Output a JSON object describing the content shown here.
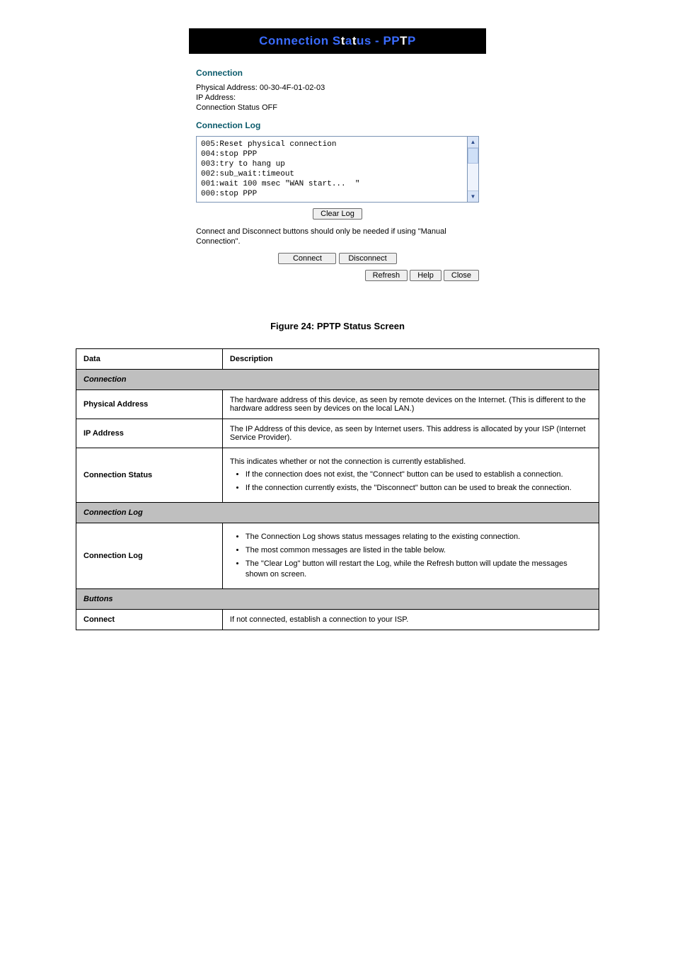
{
  "screenshot": {
    "banner_prefix": "Connection S",
    "banner_mid": "t",
    "banner_suffix_a": "a",
    "banner_t2": "t",
    "banner_suffix_b": "us - PP",
    "banner_t3": "T",
    "banner_end": "P",
    "section_connection": "Connection",
    "phys_line": "Physical Address:  00-30-4F-01-02-03",
    "ip_line": "IP Address:",
    "status_line": "Connection Status OFF",
    "section_log": "Connection Log",
    "log_text": "005:Reset physical connection\n004:stop PPP\n003:try to hang up\n002:sub_wait:timeout\n001:wait 100 msec \"WAN start...  \"\n000:stop PPP",
    "clear_log": "Clear Log",
    "note": "Connect and Disconnect buttons should only be needed if using \"Manual Connection\".",
    "connect": "Connect",
    "disconnect": "Disconnect",
    "refresh": "Refresh",
    "help": "Help",
    "close": "Close"
  },
  "figcap": "Figure 24: PPTP Status Screen",
  "table": {
    "head_data": "Data",
    "head_desc": "Description",
    "group_connection": "Connection",
    "rows_connection": [
      {
        "label": "Physical Address",
        "desc": "The hardware address of this device, as seen by remote devices on the Internet. (This is different to the hardware address seen by devices on the local LAN.)"
      },
      {
        "label": "IP Address",
        "desc": "The IP Address of this device, as seen by Internet users. This address is allocated by your ISP (Internet Service Provider)."
      }
    ],
    "row_conn_status": {
      "label": "Connection Status",
      "intro": "This indicates whether or not the connection is currently established.",
      "b1": "If the connection does not exist, the \"Connect\" button can be used to establish a connection.",
      "b2": "If the connection currently exists, the \"Disconnect\" button can be used to break the connection."
    },
    "group_log": "Connection Log",
    "row_log": {
      "label": "Connection Log",
      "b1": "The Connection Log shows status messages relating to the existing connection.",
      "b2": "The most common messages are listed in the table below.",
      "b3": "The \"Clear Log\" button will restart the Log, while the Refresh button will update the messages shown on screen."
    },
    "group_buttons": "Buttons",
    "row_connect": {
      "label": "Connect",
      "desc": "If not connected, establish a connection to your ISP."
    }
  }
}
